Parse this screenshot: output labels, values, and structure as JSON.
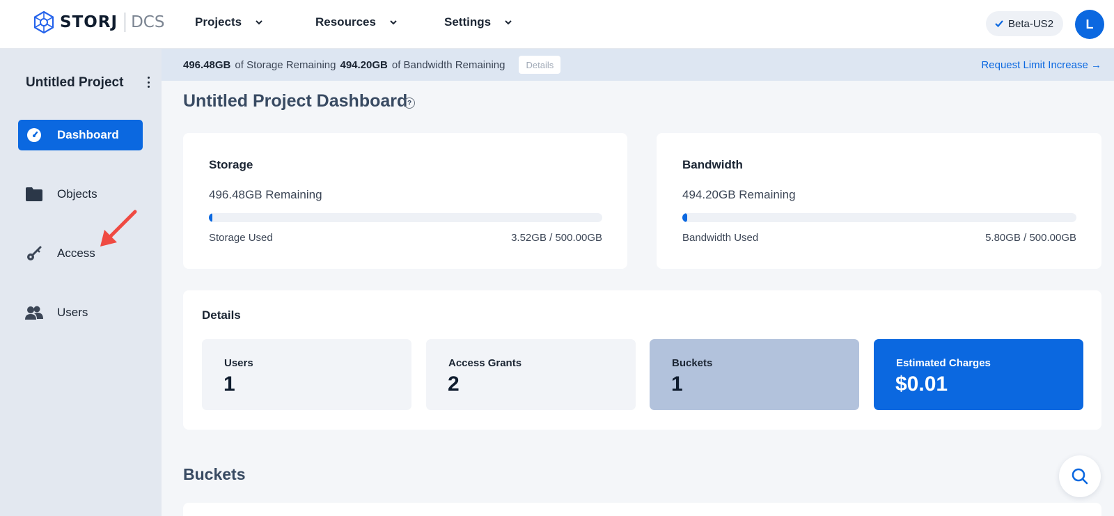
{
  "header": {
    "logo_word": "STORJ",
    "logo_product": "DCS",
    "nav": [
      {
        "label": "Projects"
      },
      {
        "label": "Resources"
      },
      {
        "label": "Settings"
      }
    ],
    "region": "Beta-US2",
    "avatar_initial": "L"
  },
  "sidebar": {
    "project_name": "Untitled Project",
    "items": [
      {
        "label": "Dashboard",
        "icon": "dashboard-gauge-icon",
        "active": true
      },
      {
        "label": "Objects",
        "icon": "folder-icon",
        "active": false
      },
      {
        "label": "Access",
        "icon": "key-icon",
        "active": false
      },
      {
        "label": "Users",
        "icon": "users-icon",
        "active": false
      }
    ]
  },
  "banner": {
    "storage_value": "496.48GB",
    "storage_text": "of Storage Remaining",
    "bandwidth_value": "494.20GB",
    "bandwidth_text": "of Bandwidth Remaining",
    "details_label": "Details",
    "request_link": "Request Limit Increase →"
  },
  "main": {
    "title": "Untitled Project Dashboard",
    "help_symbol": "?",
    "storage": {
      "title": "Storage",
      "remaining": "496.48GB Remaining",
      "used_label": "Storage Used",
      "used_value": "3.52GB / 500.00GB",
      "used_fraction": 0.00704
    },
    "bandwidth": {
      "title": "Bandwidth",
      "remaining": "494.20GB Remaining",
      "used_label": "Bandwidth Used",
      "used_value": "5.80GB / 500.00GB",
      "used_fraction": 0.0116
    },
    "details": {
      "title": "Details",
      "stats": [
        {
          "label": "Users",
          "value": "1"
        },
        {
          "label": "Access Grants",
          "value": "2"
        },
        {
          "label": "Buckets",
          "value": "1"
        },
        {
          "label": "Estimated Charges",
          "value": "$0.01"
        }
      ]
    },
    "buckets_title": "Buckets"
  },
  "colors": {
    "accent": "#0b68e0",
    "sidebar_bg": "#e3e8f0",
    "banner_bg": "#dde6f2",
    "annotation_arrow": "#ef4a42"
  }
}
